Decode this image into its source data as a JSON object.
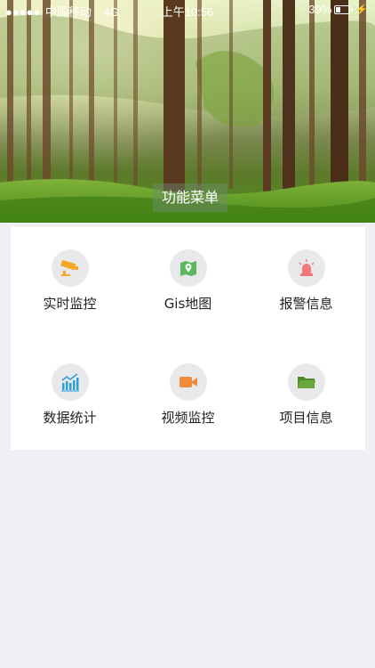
{
  "status_bar": {
    "signal_dots": "●●●●●",
    "carrier": "中国移动",
    "network": "4G",
    "time": "上午10:56",
    "battery_text": "39%",
    "battery_level": 0.39
  },
  "banner": {
    "title": "功能菜单"
  },
  "menu": {
    "items": [
      {
        "label": "实时监控",
        "icon": "cctv-camera-icon",
        "color": "#f5a623"
      },
      {
        "label": "Gis地图",
        "icon": "map-pin-icon",
        "color": "#5cb85c"
      },
      {
        "label": "报警信息",
        "icon": "alarm-siren-icon",
        "color": "#f07a7a"
      },
      {
        "label": "数据统计",
        "icon": "bar-chart-icon",
        "color": "#2b9fd8"
      },
      {
        "label": "视频监控",
        "icon": "video-camera-icon",
        "color": "#f08a3c"
      },
      {
        "label": "项目信息",
        "icon": "folder-icon",
        "color": "#4e8a2c"
      }
    ]
  }
}
